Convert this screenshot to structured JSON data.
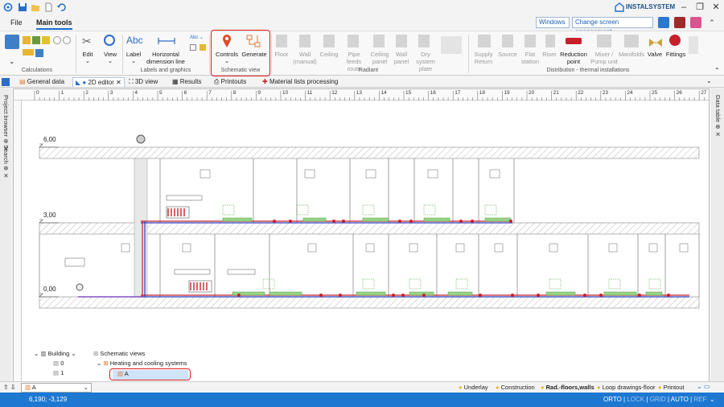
{
  "app": {
    "logo_text": "INSTALSYSTEM"
  },
  "menu": {
    "file": "File",
    "main_tools": "Main tools"
  },
  "window_controls": {
    "windows_select": "Windows",
    "arrangement_select": "Change screen arrangement"
  },
  "ribbon": {
    "groups": {
      "calculations": "Calculations",
      "labels_graphics": "Labels and graphics",
      "schematic_view": "Schematic view",
      "radiant": "Radiant",
      "distribution": "Distribution - thermal installations"
    },
    "buttons": {
      "edit": "Edit",
      "view": "View",
      "label": "Label",
      "horizontal_dimension": "Horizontal dimension line",
      "controls": "Controls",
      "generate": "Generate",
      "floor": "Floor",
      "wall_manual": "Wall (manual)",
      "ceiling": "Ceiling",
      "pipe_feeds_route": "Pipe feeds route",
      "ceiling_panel": "Ceiling panel",
      "wall_panel": "Wall panel",
      "dry_system_plate": "Dry system plate",
      "supply_return": "Supply Return",
      "source": "Source",
      "flat_station": "Flat station",
      "riser": "Riser",
      "reduction_point": "Reduction point",
      "mixer_pump_unit": "Mixer / Pump unit",
      "manifolds": "Manifolds",
      "valve": "Valve",
      "fittings": "Fittings"
    }
  },
  "tabs": [
    "General data",
    "2D editor",
    "3D view",
    "Results",
    "Printouts",
    "Material lists processing"
  ],
  "side_panels": {
    "left_top": "Project browser",
    "left_bottom": "Search",
    "right": "Data table"
  },
  "ruler_marks": [
    "0",
    "1",
    "2",
    "3",
    "4",
    "5",
    "6",
    "7",
    "8",
    "9",
    "10",
    "11",
    "12",
    "13",
    "14",
    "15",
    "16",
    "17",
    "18",
    "19",
    "20",
    "21",
    "22",
    "23",
    "24",
    "25",
    "26",
    "27"
  ],
  "drawing": {
    "levels": [
      "6,00",
      "3,00",
      "0,00"
    ]
  },
  "tree": {
    "building": "Building",
    "floors": [
      "0",
      "1"
    ],
    "schematic_views": "Schematic views",
    "heating_cooling": "Heating and cooling systems",
    "selected": "A"
  },
  "bottom": {
    "view_select": "A",
    "layers": [
      "Underlay",
      "Construction",
      "Rad.-floors,walls",
      "Loop drawings-floor",
      "Printout"
    ]
  },
  "status": {
    "coords": "6,190; -3,129",
    "modes": [
      "ORTO",
      "LOCK",
      "GRID",
      "AUTO",
      "REF"
    ]
  }
}
